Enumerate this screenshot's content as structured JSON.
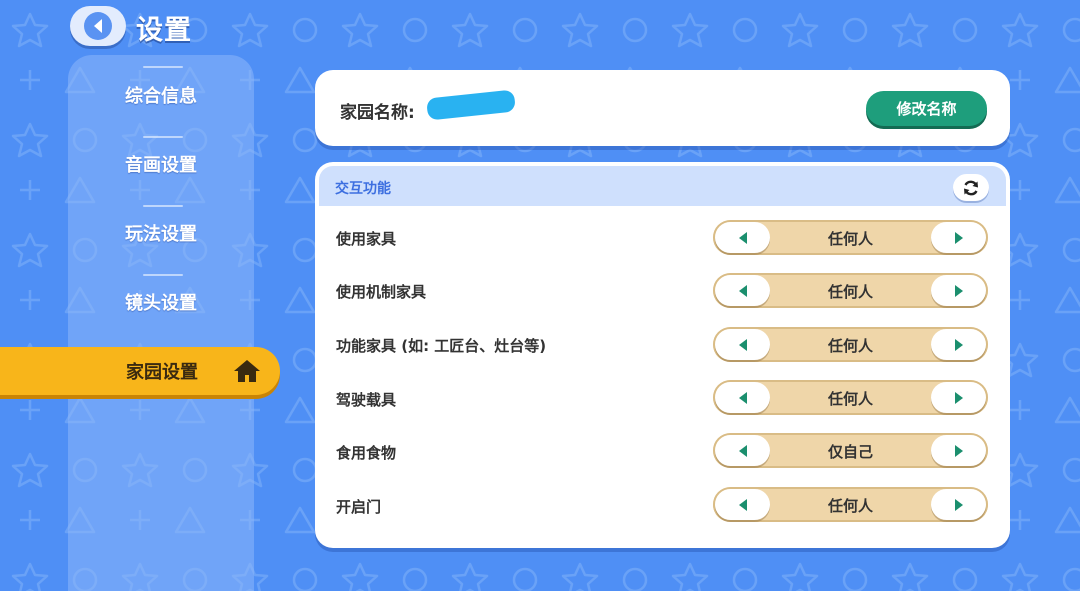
{
  "header": {
    "title": "设置",
    "back_icon": "chevron-left-icon"
  },
  "sidebar": {
    "items": [
      {
        "label": "综合信息"
      },
      {
        "label": "音画设置"
      },
      {
        "label": "玩法设置"
      },
      {
        "label": "镜头设置"
      },
      {
        "label": "家园设置",
        "active": true,
        "icon": "home-icon"
      }
    ]
  },
  "home": {
    "name_label": "家园名称:",
    "name_value": "",
    "rename_label": "修改名称"
  },
  "interaction": {
    "title": "交互功能",
    "refresh_icon": "refresh-icon",
    "rows": [
      {
        "label": "使用家具",
        "value": "任何人"
      },
      {
        "label": "使用机制家具",
        "value": "任何人"
      },
      {
        "label": "功能家具 (如: 工匠台、灶台等)",
        "value": "任何人"
      },
      {
        "label": "驾驶载具",
        "value": "任何人"
      },
      {
        "label": "食用食物",
        "value": "仅自己"
      },
      {
        "label": "开启门",
        "value": "任何人"
      }
    ]
  },
  "colors": {
    "background": "#4f8ff5",
    "active_tab": "#f8b51a",
    "rename_button": "#1e9e7c",
    "selector_fill": "#efd6a9",
    "arrow": "#1b8f6e",
    "panel_header": "#cfe0fd"
  }
}
